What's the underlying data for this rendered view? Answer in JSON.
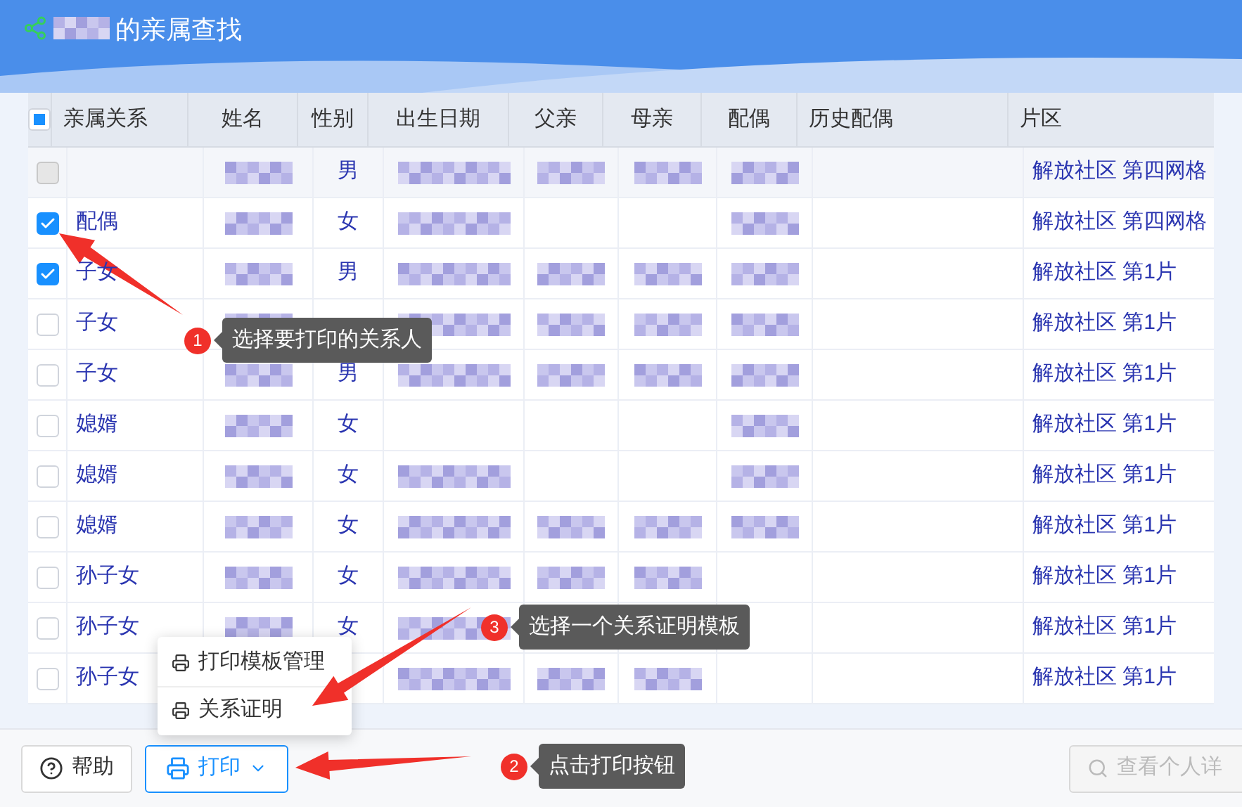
{
  "window": {
    "title": "的亲属查找",
    "title_prefix_blurred": true
  },
  "table": {
    "select_all": {
      "indeterminate": true
    },
    "columns": [
      "亲属关系",
      "姓名",
      "性别",
      "出生日期",
      "父亲",
      "母亲",
      "配偶",
      "历史配偶",
      "片区"
    ],
    "rows": [
      {
        "checked": false,
        "disabled": true,
        "cells": [
          {
            "kind": "empty"
          },
          {
            "kind": "blurred"
          },
          {
            "kind": "text",
            "text": "男"
          },
          {
            "kind": "blurred"
          },
          {
            "kind": "blurred"
          },
          {
            "kind": "blurred"
          },
          {
            "kind": "blurred"
          },
          {
            "kind": "empty"
          },
          {
            "kind": "text",
            "text": "解放社区 第四网格"
          }
        ]
      },
      {
        "checked": true,
        "disabled": false,
        "cells": [
          {
            "kind": "text",
            "text": "配偶"
          },
          {
            "kind": "blurred"
          },
          {
            "kind": "text",
            "text": "女"
          },
          {
            "kind": "blurred"
          },
          {
            "kind": "empty"
          },
          {
            "kind": "empty"
          },
          {
            "kind": "blurred"
          },
          {
            "kind": "empty"
          },
          {
            "kind": "text",
            "text": "解放社区 第四网格"
          }
        ]
      },
      {
        "checked": true,
        "disabled": false,
        "cells": [
          {
            "kind": "text",
            "text": "子女"
          },
          {
            "kind": "blurred"
          },
          {
            "kind": "text",
            "text": "男"
          },
          {
            "kind": "blurred"
          },
          {
            "kind": "blurred"
          },
          {
            "kind": "blurred"
          },
          {
            "kind": "blurred"
          },
          {
            "kind": "empty"
          },
          {
            "kind": "text",
            "text": "解放社区 第1片"
          }
        ]
      },
      {
        "checked": false,
        "disabled": false,
        "cells": [
          {
            "kind": "text",
            "text": "子女"
          },
          {
            "kind": "blurred"
          },
          {
            "kind": "empty"
          },
          {
            "kind": "blurred"
          },
          {
            "kind": "blurred"
          },
          {
            "kind": "blurred"
          },
          {
            "kind": "blurred"
          },
          {
            "kind": "empty"
          },
          {
            "kind": "text",
            "text": "解放社区 第1片"
          }
        ]
      },
      {
        "checked": false,
        "disabled": false,
        "cells": [
          {
            "kind": "text",
            "text": "子女"
          },
          {
            "kind": "blurred"
          },
          {
            "kind": "text",
            "text": "男"
          },
          {
            "kind": "blurred"
          },
          {
            "kind": "blurred"
          },
          {
            "kind": "blurred"
          },
          {
            "kind": "blurred"
          },
          {
            "kind": "empty"
          },
          {
            "kind": "text",
            "text": "解放社区 第1片"
          }
        ]
      },
      {
        "checked": false,
        "disabled": false,
        "cells": [
          {
            "kind": "text",
            "text": "媳婿"
          },
          {
            "kind": "blurred"
          },
          {
            "kind": "text",
            "text": "女"
          },
          {
            "kind": "empty"
          },
          {
            "kind": "empty"
          },
          {
            "kind": "empty"
          },
          {
            "kind": "blurred"
          },
          {
            "kind": "empty"
          },
          {
            "kind": "text",
            "text": "解放社区 第1片"
          }
        ]
      },
      {
        "checked": false,
        "disabled": false,
        "cells": [
          {
            "kind": "text",
            "text": "媳婿"
          },
          {
            "kind": "blurred"
          },
          {
            "kind": "text",
            "text": "女"
          },
          {
            "kind": "blurred"
          },
          {
            "kind": "empty"
          },
          {
            "kind": "empty"
          },
          {
            "kind": "blurred"
          },
          {
            "kind": "empty"
          },
          {
            "kind": "text",
            "text": "解放社区 第1片"
          }
        ]
      },
      {
        "checked": false,
        "disabled": false,
        "cells": [
          {
            "kind": "text",
            "text": "媳婿"
          },
          {
            "kind": "blurred"
          },
          {
            "kind": "text",
            "text": "女"
          },
          {
            "kind": "blurred"
          },
          {
            "kind": "blurred"
          },
          {
            "kind": "blurred"
          },
          {
            "kind": "blurred"
          },
          {
            "kind": "empty"
          },
          {
            "kind": "text",
            "text": "解放社区 第1片"
          }
        ]
      },
      {
        "checked": false,
        "disabled": false,
        "cells": [
          {
            "kind": "text",
            "text": "孙子女"
          },
          {
            "kind": "blurred"
          },
          {
            "kind": "text",
            "text": "女"
          },
          {
            "kind": "blurred"
          },
          {
            "kind": "blurred"
          },
          {
            "kind": "blurred"
          },
          {
            "kind": "empty"
          },
          {
            "kind": "empty"
          },
          {
            "kind": "text",
            "text": "解放社区 第1片"
          }
        ]
      },
      {
        "checked": false,
        "disabled": false,
        "cells": [
          {
            "kind": "text",
            "text": "孙子女"
          },
          {
            "kind": "blurred"
          },
          {
            "kind": "text",
            "text": "女"
          },
          {
            "kind": "blurred"
          },
          {
            "kind": "empty"
          },
          {
            "kind": "empty"
          },
          {
            "kind": "empty"
          },
          {
            "kind": "empty"
          },
          {
            "kind": "text",
            "text": "解放社区 第1片"
          }
        ]
      },
      {
        "checked": false,
        "disabled": false,
        "cells": [
          {
            "kind": "text",
            "text": "孙子女"
          },
          {
            "kind": "empty"
          },
          {
            "kind": "empty"
          },
          {
            "kind": "blurred"
          },
          {
            "kind": "blurred"
          },
          {
            "kind": "blurred"
          },
          {
            "kind": "empty"
          },
          {
            "kind": "empty"
          },
          {
            "kind": "text",
            "text": "解放社区 第1片"
          }
        ]
      }
    ]
  },
  "print_menu": {
    "items": [
      "打印模板管理",
      "关系证明"
    ]
  },
  "footer": {
    "help_button": "帮助",
    "print_button": {
      "label": "打印",
      "expanded": true
    },
    "search": {
      "placeholder": "查看个人详"
    }
  },
  "callouts": [
    {
      "number": "1",
      "text": "选择要打印的关系人"
    },
    {
      "number": "3",
      "text": "选择一个关系证明模板"
    },
    {
      "number": "2",
      "text": "点击打印按钮"
    }
  ]
}
